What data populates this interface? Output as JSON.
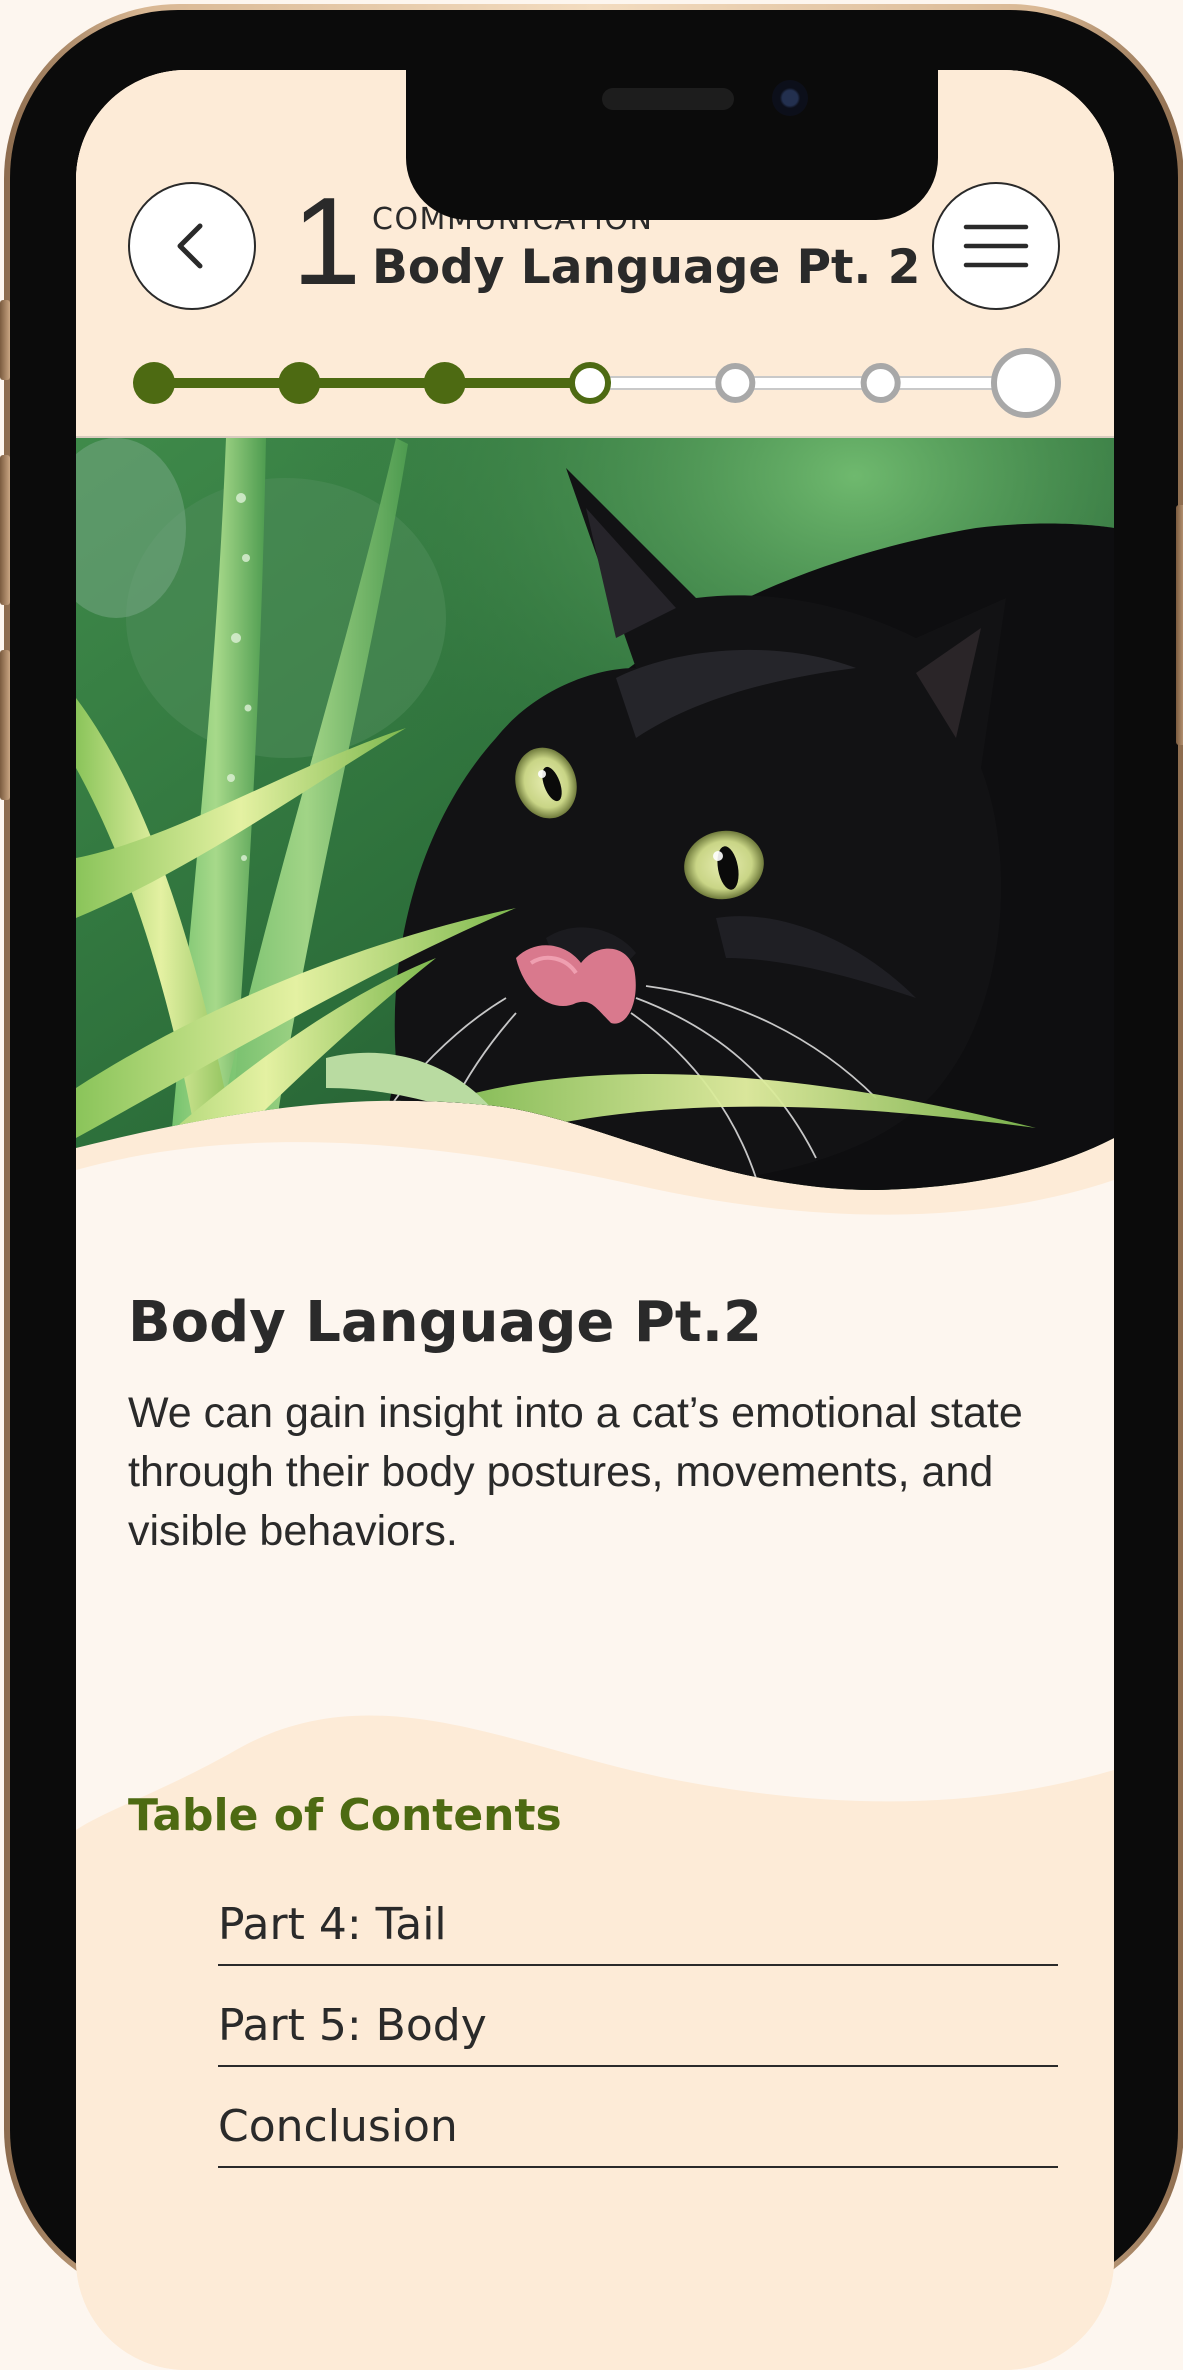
{
  "header": {
    "chapter_number": "1",
    "kicker": "COMMUNICATION",
    "title": "Body Language Pt. 2"
  },
  "progress": {
    "total_steps": 7,
    "completed_steps": 3,
    "current_step": 4
  },
  "hero": {
    "image_icon": "black-cat-photo"
  },
  "intro": {
    "title": "Body Language Pt.2",
    "body": "We can gain insight into a cat’s emotional state through their body postures, movements, and visible behaviors."
  },
  "toc": {
    "title": "Table of Contents",
    "items": [
      {
        "label": "Part 4: Tail"
      },
      {
        "label": "Part 5: Body"
      },
      {
        "label": "Conclusion"
      }
    ]
  },
  "colors": {
    "accent_green": "#4d6a12",
    "progress_inactive": "#a8a8a8",
    "background_light": "#fdf6ef",
    "background_peach": "#fdebd7",
    "text_dark": "#2a2a2a"
  }
}
